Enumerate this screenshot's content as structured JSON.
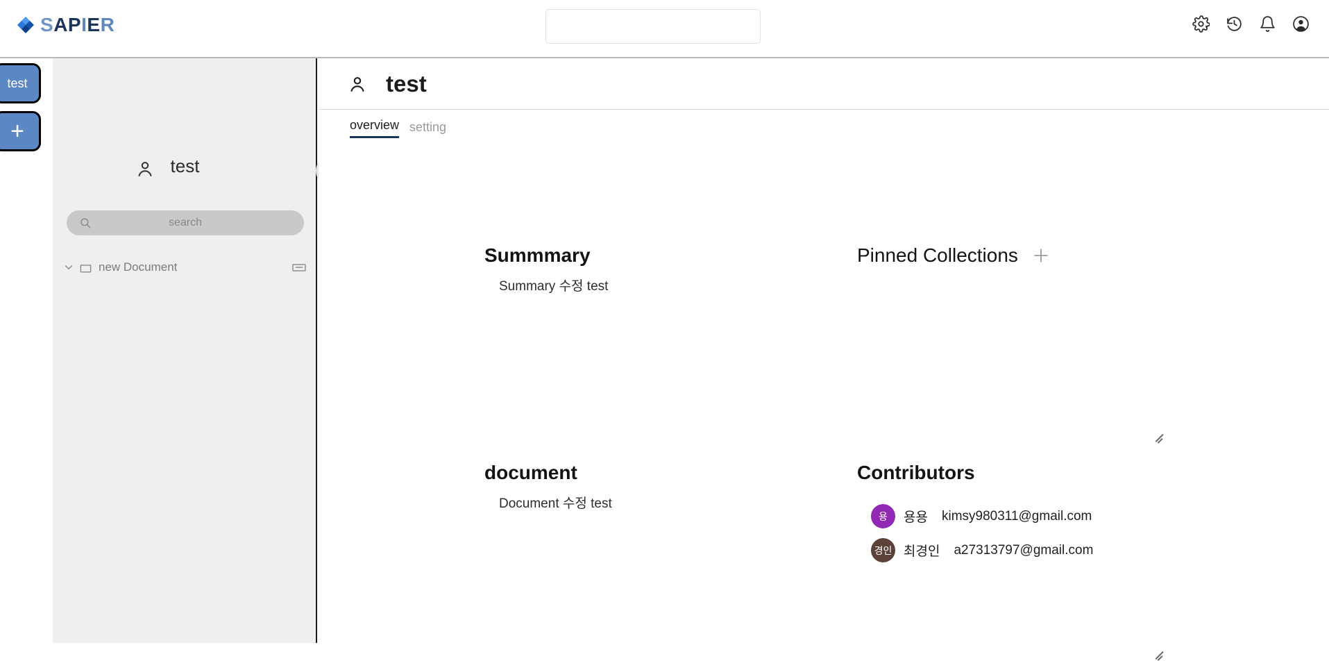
{
  "app": {
    "brand_parts": [
      "S",
      "AP",
      "I",
      "E",
      "R"
    ],
    "brand_full": "SAPIER"
  },
  "topbar": {
    "search_value": "",
    "search_placeholder": "",
    "icons": [
      {
        "name": "gear-icon",
        "label": "Settings"
      },
      {
        "name": "history-icon",
        "label": "History"
      },
      {
        "name": "bell-icon",
        "label": "Notifications"
      },
      {
        "name": "account-icon",
        "label": "Account"
      }
    ]
  },
  "rail": {
    "workspaces": [
      {
        "label": "test",
        "color": "#5b87c5"
      }
    ],
    "add_label": "+"
  },
  "sidebar": {
    "person_icon": "person-icon",
    "title": "test",
    "add_label": "+",
    "search_value": "",
    "search_placeholder": "search",
    "tree": [
      {
        "label": "new Document",
        "icon": "folder-icon",
        "expanded": true,
        "chevron": "chevron-down-icon"
      }
    ]
  },
  "main": {
    "person_icon": "person-icon",
    "title": "test",
    "tabs": [
      {
        "label": "overview",
        "active": true
      },
      {
        "label": "setting",
        "active": false
      }
    ],
    "summary": {
      "title": "Summmary",
      "text": "Summary 수정 test"
    },
    "document": {
      "title": "document",
      "text": "Document 수정 test"
    },
    "pinned": {
      "title": "Pinned Collections",
      "add_label": "+",
      "items": []
    },
    "contributors": {
      "title": "Contributors",
      "items": [
        {
          "initials": "용",
          "name": "용용",
          "email": "kimsy980311@gmail.com",
          "color": "#9129b5"
        },
        {
          "initials": "경인",
          "name": "최경인",
          "email": "a27313797@gmail.com",
          "color": "#5b4138"
        }
      ]
    }
  },
  "colors": {
    "accent_blue": "#5b87c5",
    "tab_underline": "#17365c",
    "sidebar_bg": "#efefef",
    "search_bg": "#c9c9c9"
  }
}
